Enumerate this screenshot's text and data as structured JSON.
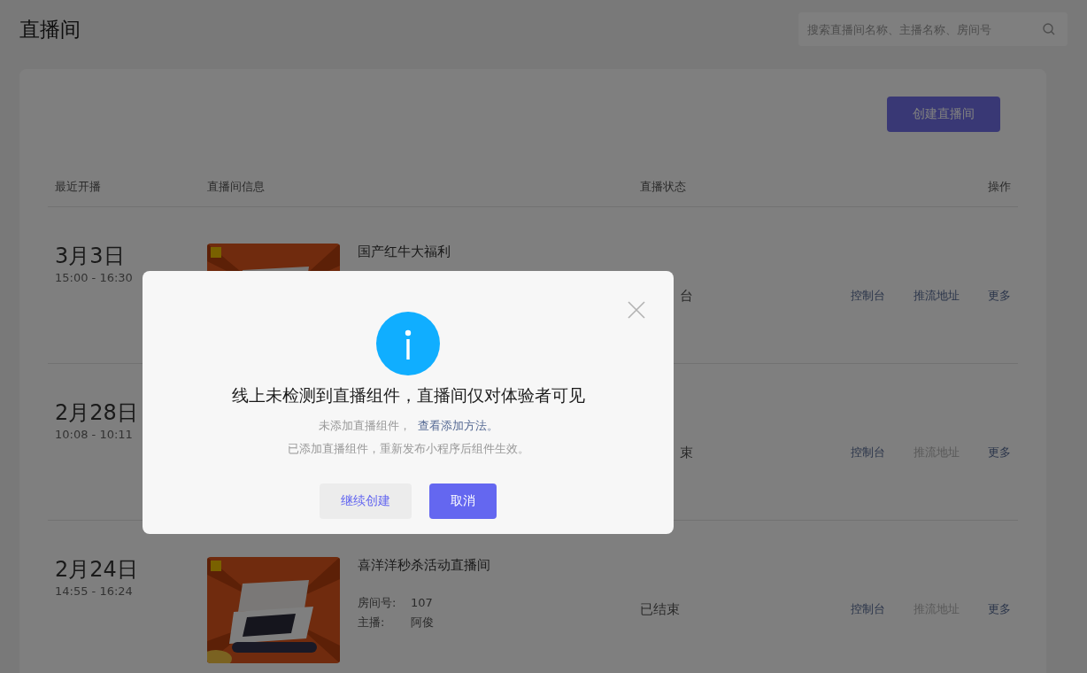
{
  "page": {
    "title": "直播间"
  },
  "search": {
    "placeholder": "搜索直播间名称、主播名称、房间号"
  },
  "create_button": "创建直播间",
  "table": {
    "columns": [
      "最近开播",
      "直播间信息",
      "直播状态",
      "操作"
    ],
    "rows": [
      {
        "date": "3月3日",
        "time": "15:00 - 16:30",
        "thumbnail": {
          "kind": "picture"
        },
        "title": "国产红牛大福利",
        "status": "台",
        "actions": [
          {
            "label": "控制台",
            "disabled": false
          },
          {
            "label": "推流地址",
            "disabled": false
          },
          {
            "label": "更多",
            "disabled": false
          }
        ]
      },
      {
        "date": "2月28日",
        "time": "10:08 - 10:11",
        "status": "束",
        "actions": [
          {
            "label": "控制台",
            "disabled": false
          },
          {
            "label": "推流地址",
            "disabled": true
          },
          {
            "label": "更多",
            "disabled": false
          }
        ]
      },
      {
        "date": "2月24日",
        "time": "14:55 - 16:24",
        "thumbnail": {
          "kind": "picture"
        },
        "title": "喜洋洋秒杀活动直播间",
        "room_label": "房间号:",
        "room": "107",
        "host_label": "主播:",
        "host": "阿俊",
        "status": "已结束",
        "actions": [
          {
            "label": "控制台",
            "disabled": false
          },
          {
            "label": "推流地址",
            "disabled": true
          },
          {
            "label": "更多",
            "disabled": false
          }
        ]
      }
    ]
  },
  "dialog": {
    "title": "线上未检测到直播组件，直播间仅对体验者可见",
    "line_1": "未添加直播组件，",
    "line_1_link": "查看添加方法。",
    "line_2": "已添加直播组件，重新发布小程序后组件生效。",
    "buttons": [
      {
        "label": "继续创建",
        "kind": "secondary"
      },
      {
        "label": "取消",
        "kind": "primary"
      }
    ]
  }
}
